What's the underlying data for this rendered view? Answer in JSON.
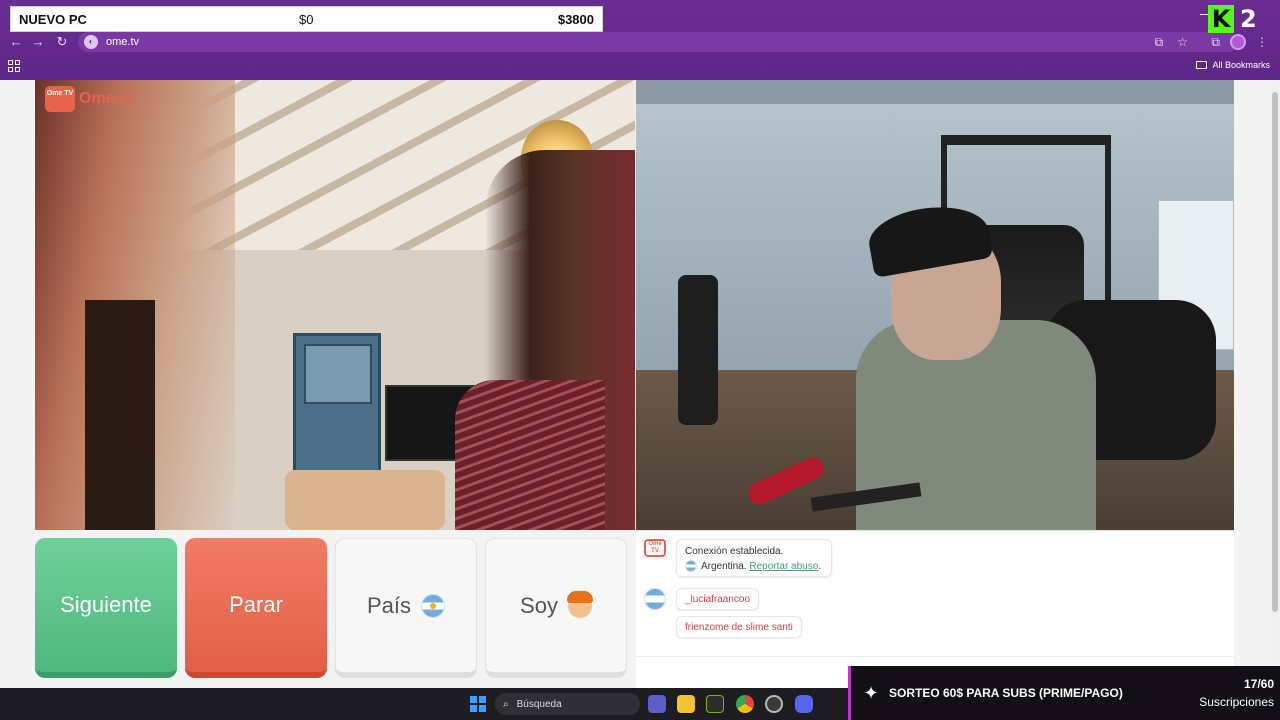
{
  "goal": {
    "title": "NUEVO PC",
    "current": "$0",
    "target": "$3800"
  },
  "stream_badge": {
    "label": "2"
  },
  "browser": {
    "url": "ome.tv",
    "site_icon": "ome-tv-favicon",
    "bookmarks_label": "All Bookmarks"
  },
  "ometv": {
    "logo_box": "Ome TV",
    "logo_word": "Ome.tv",
    "buttons": {
      "next": "Siguiente",
      "stop": "Parar",
      "country": "País",
      "soy": "Soy"
    },
    "chat": {
      "system_line1": "Conexión establecida.",
      "country": "Argentina.",
      "report": "Reportar abuso",
      "report_suffix": ".",
      "username": "_luciafraancoo",
      "message": "frienzome de slime santi"
    }
  },
  "taskbar": {
    "search_placeholder": "Búsqueda"
  },
  "sub_alert": {
    "text": "SORTEO 60$ PARA SUBS (PRIME/PAGO)",
    "count": "17/60",
    "label": "Suscripciones"
  },
  "colors": {
    "chrome": "#6b2f8f",
    "next": "#5cc48a",
    "stop": "#e8624c",
    "kick": "#53fc18"
  }
}
